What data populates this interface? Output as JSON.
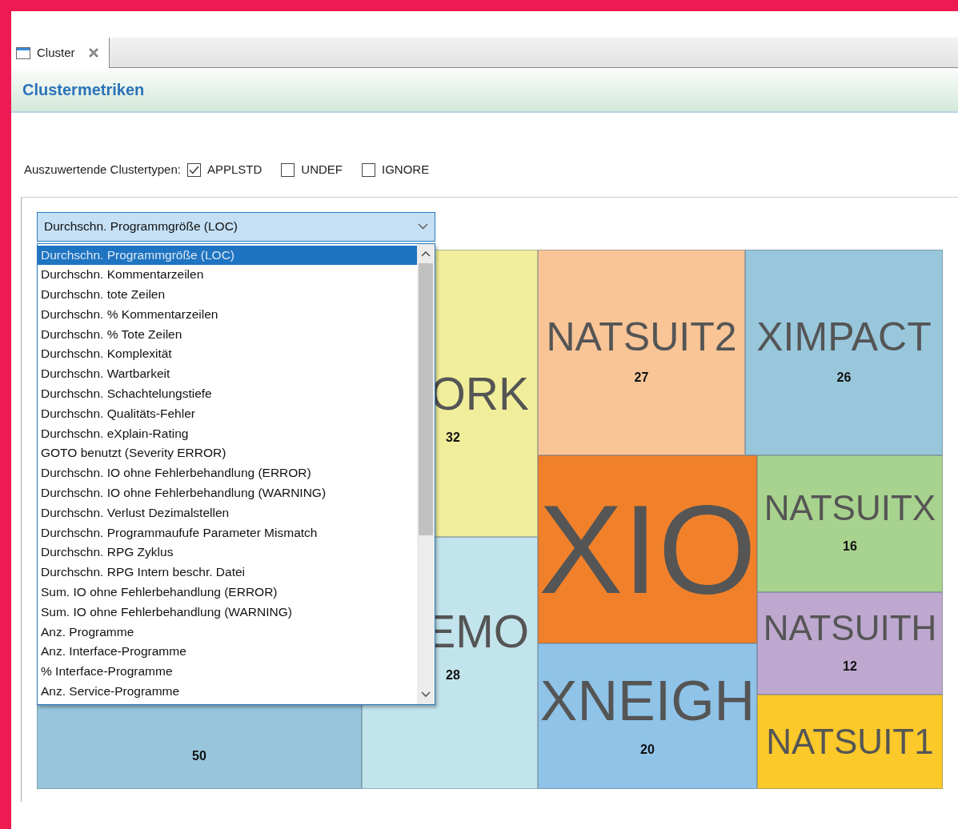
{
  "tab": {
    "title": "Cluster",
    "selected": true
  },
  "header": {
    "title": "Clustermetriken"
  },
  "filter": {
    "label": "Auszuwertende Clustertypen:",
    "options": [
      {
        "label": "APPLSTD",
        "checked": true
      },
      {
        "label": "UNDEF",
        "checked": false
      },
      {
        "label": "IGNORE",
        "checked": false
      }
    ]
  },
  "metric_dropdown": {
    "value": "Durchschn. Programmgröße (LOC)",
    "expanded": true,
    "items": [
      {
        "label": "Durchschn. Programmgröße (LOC)",
        "selected": true
      },
      {
        "label": "Durchschn. Kommentarzeilen",
        "selected": false
      },
      {
        "label": "Durchschn. tote Zeilen",
        "selected": false
      },
      {
        "label": "Durchschn. % Kommentarzeilen",
        "selected": false
      },
      {
        "label": "Durchschn. % Tote Zeilen",
        "selected": false
      },
      {
        "label": "Durchschn. Komplexität",
        "selected": false
      },
      {
        "label": "Durchschn. Wartbarkeit",
        "selected": false
      },
      {
        "label": "Durchschn. Schachtelungstiefe",
        "selected": false
      },
      {
        "label": "Durchschn. Qualitäts-Fehler",
        "selected": false
      },
      {
        "label": "Durchschn. eXplain-Rating",
        "selected": false
      },
      {
        "label": "GOTO benutzt (Severity ERROR)",
        "selected": false
      },
      {
        "label": "Durchschn. IO ohne Fehlerbehandlung (ERROR)",
        "selected": false
      },
      {
        "label": "Durchschn. IO ohne Fehlerbehandlung (WARNING)",
        "selected": false
      },
      {
        "label": "Durchschn. Verlust Dezimalstellen",
        "selected": false
      },
      {
        "label": "Durchschn. Programmaufufe Parameter Mismatch",
        "selected": false
      },
      {
        "label": "Durchschn. RPG Zyklus",
        "selected": false
      },
      {
        "label": "Durchschn. RPG Intern beschr. Datei",
        "selected": false
      },
      {
        "label": "Sum. IO ohne Fehlerbehandlung (ERROR)",
        "selected": false
      },
      {
        "label": "Sum. IO ohne Fehlerbehandlung (WARNING)",
        "selected": false
      },
      {
        "label": "Anz. Programme",
        "selected": false
      },
      {
        "label": "Anz. Interface-Programme",
        "selected": false
      },
      {
        "label": "% Interface-Programme",
        "selected": false
      },
      {
        "label": "Anz. Service-Programme",
        "selected": false
      }
    ]
  },
  "treemap": {
    "tiles": [
      {
        "value": "50",
        "color": "#97c6dc"
      },
      {
        "label": "ORK",
        "value": "32",
        "color": "#f1ee9b"
      },
      {
        "label": "EMO",
        "value": "28",
        "color": "#c2e4ec"
      },
      {
        "label": "NATSUIT2",
        "value": "27",
        "color": "#f9c597"
      },
      {
        "label": "XIMPACT",
        "value": "26",
        "color": "#98c7dc"
      },
      {
        "label": "XIO",
        "color": "#f0812a"
      },
      {
        "label": "XNEIGH",
        "value": "20",
        "color": "#8fc3e8"
      },
      {
        "label": "NATSUITX",
        "value": "16",
        "color": "#a8d38e"
      },
      {
        "label": "NATSUITH",
        "value": "12",
        "color": "#bea8cf"
      },
      {
        "label": "NATSUIT1",
        "color": "#fcc92a"
      }
    ]
  }
}
